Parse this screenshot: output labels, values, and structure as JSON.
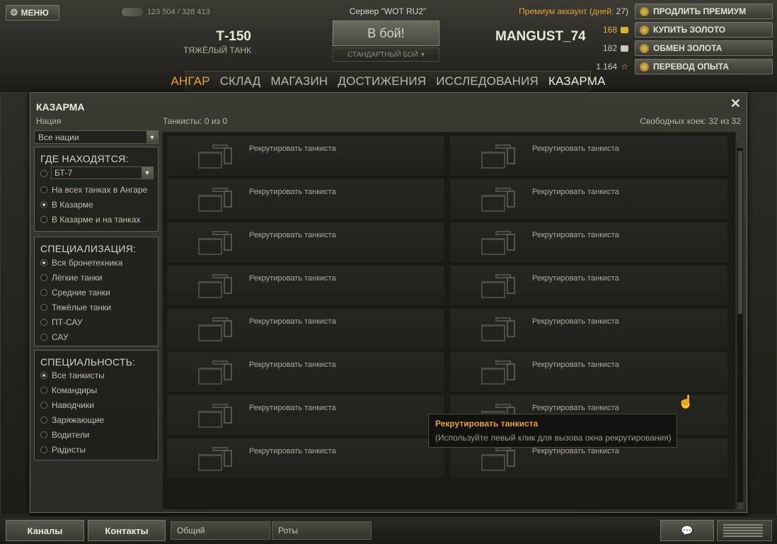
{
  "header": {
    "menu_label": "МЕНЮ",
    "online_count": "123 504 / 328 413",
    "server_label": "Сервер \"WOT RU2\"",
    "tank_name": "Т-150",
    "tank_type": "ТЯЖЁЛЫЙ ТАНК",
    "battle_button": "В бой!",
    "battle_mode": "СТАНДАРТНЫЙ БОЙ",
    "player_name": "MANGUST_74",
    "premium_label": "Премиум аккаунт (дней:",
    "premium_days": "27)",
    "gold": "168",
    "credits": "182",
    "free_xp": "1 164",
    "buttons": {
      "extend_premium": "ПРОДЛИТЬ ПРЕМИУМ",
      "buy_gold": "КУПИТЬ ЗОЛОТО",
      "exchange_gold": "ОБМЕН ЗОЛОТА",
      "transfer_xp": "ПЕРЕВОД ОПЫТА"
    }
  },
  "nav": {
    "tabs": [
      {
        "label": "АНГАР"
      },
      {
        "label": "СКЛАД"
      },
      {
        "label": "МАГАЗИН"
      },
      {
        "label": "ДОСТИЖЕНИЯ"
      },
      {
        "label": "ИССЛЕДОВАНИЯ"
      },
      {
        "label": "КАЗАРМА"
      }
    ]
  },
  "barracks": {
    "title": "КАЗАРМА",
    "nation_label": "Нация",
    "tankers_label": "Танкисты: 0 из 0",
    "free_beds_label": "Свободных коек: 32 из 32",
    "nation_select": "Все нации",
    "location": {
      "header": "ГДЕ НАХОДЯТСЯ:",
      "tank_select": "БТ-7",
      "options": [
        "На всех танках в Ангаре",
        "В Казарме",
        "В Казарме и на танках"
      ]
    },
    "specialization": {
      "header": "СПЕЦИАЛИЗАЦИЯ:",
      "options": [
        "Вся бронетехника",
        "Лёгкие танки",
        "Средние танки",
        "Тяжёлые танки",
        "ПТ-САУ",
        "САУ"
      ]
    },
    "role": {
      "header": "СПЕЦИАЛЬНОСТЬ:",
      "options": [
        "Все танкисты",
        "Командиры",
        "Наводчики",
        "Заряжающие",
        "Водители",
        "Радисты"
      ]
    },
    "recruit_label": "Рекрутировать танкиста"
  },
  "tooltip": {
    "title": "Рекрутировать танкиста",
    "hint": "(Используйте левый клик для вызова окна рекрутирования)"
  },
  "footer": {
    "channels": "Каналы",
    "contacts": "Контакты",
    "tab_general": "Общий",
    "tab_companies": "Роты"
  },
  "colors": {
    "accent_orange": "#e8a040",
    "gold": "#e8b43a"
  }
}
